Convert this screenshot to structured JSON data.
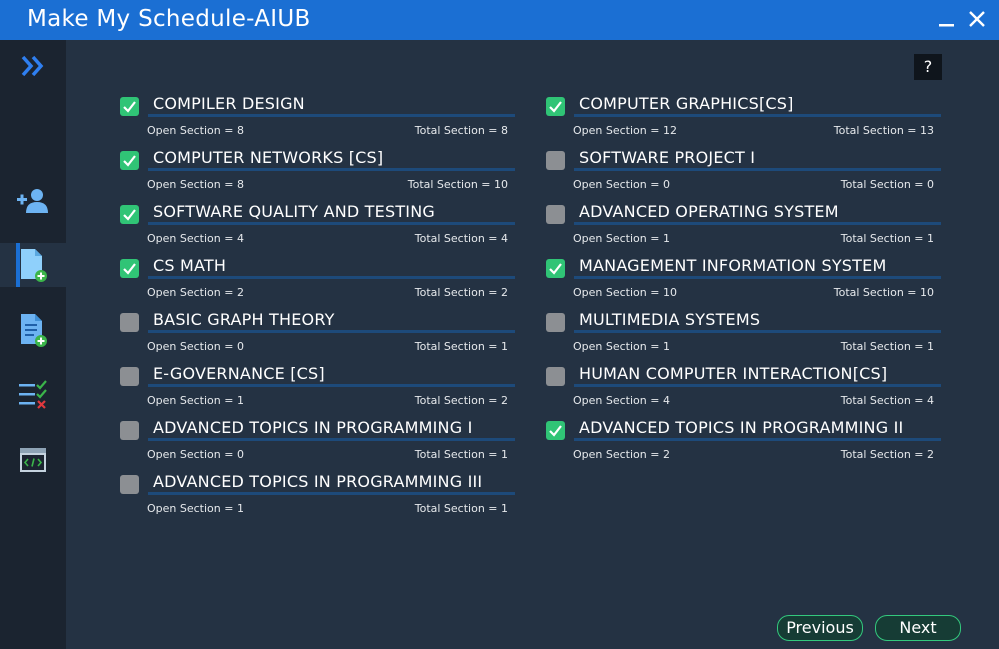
{
  "window": {
    "title": "Make My Schedule-AIUB"
  },
  "help": {
    "label": "?"
  },
  "courses_left": [
    {
      "name": "COMPILER DESIGN",
      "checked": true,
      "open": "Open Section = 8",
      "total": "Total Section = 8"
    },
    {
      "name": "COMPUTER NETWORKS [CS]",
      "checked": true,
      "open": "Open Section = 8",
      "total": "Total Section = 10"
    },
    {
      "name": "SOFTWARE QUALITY AND TESTING",
      "checked": true,
      "open": "Open Section = 4",
      "total": "Total Section = 4"
    },
    {
      "name": "CS MATH",
      "checked": true,
      "open": "Open Section = 2",
      "total": "Total Section = 2"
    },
    {
      "name": "BASIC GRAPH THEORY",
      "checked": false,
      "open": "Open Section = 0",
      "total": "Total Section = 1"
    },
    {
      "name": "E-GOVERNANCE [CS]",
      "checked": false,
      "open": "Open Section = 1",
      "total": "Total Section = 2"
    },
    {
      "name": "ADVANCED TOPICS IN PROGRAMMING I",
      "checked": false,
      "open": "Open Section = 0",
      "total": "Total Section = 1"
    },
    {
      "name": "ADVANCED TOPICS IN PROGRAMMING III",
      "checked": false,
      "open": "Open Section = 1",
      "total": "Total Section = 1"
    }
  ],
  "courses_right": [
    {
      "name": "COMPUTER GRAPHICS[CS]",
      "checked": true,
      "open": "Open Section = 12",
      "total": "Total Section = 13"
    },
    {
      "name": "SOFTWARE PROJECT I",
      "checked": false,
      "open": "Open Section = 0",
      "total": "Total Section = 0"
    },
    {
      "name": "ADVANCED OPERATING SYSTEM",
      "checked": false,
      "open": "Open Section = 1",
      "total": "Total Section = 1"
    },
    {
      "name": "MANAGEMENT INFORMATION SYSTEM",
      "checked": true,
      "open": "Open Section = 10",
      "total": "Total Section = 10"
    },
    {
      "name": "MULTIMEDIA SYSTEMS",
      "checked": false,
      "open": "Open Section = 1",
      "total": "Total Section = 1"
    },
    {
      "name": "HUMAN COMPUTER INTERACTION[CS]",
      "checked": false,
      "open": "Open Section = 4",
      "total": "Total Section = 4"
    },
    {
      "name": "ADVANCED TOPICS IN PROGRAMMING II",
      "checked": true,
      "open": "Open Section = 2",
      "total": "Total Section = 2"
    }
  ],
  "buttons": {
    "previous": "Previous",
    "next": "Next"
  },
  "sidebar": {
    "items": [
      {
        "icon": "chevron-double-right-icon"
      },
      {
        "icon": "add-user-icon"
      },
      {
        "icon": "add-document-icon",
        "active": true
      },
      {
        "icon": "add-list-document-icon"
      },
      {
        "icon": "checklist-icon"
      },
      {
        "icon": "code-window-icon"
      }
    ]
  },
  "colors": {
    "titlebar": "#1b6fd3",
    "background": "#243243",
    "sidebar": "#1b2430",
    "checked": "#30c476",
    "unchecked": "#8c8f93",
    "underline": "#1d4a7a"
  }
}
